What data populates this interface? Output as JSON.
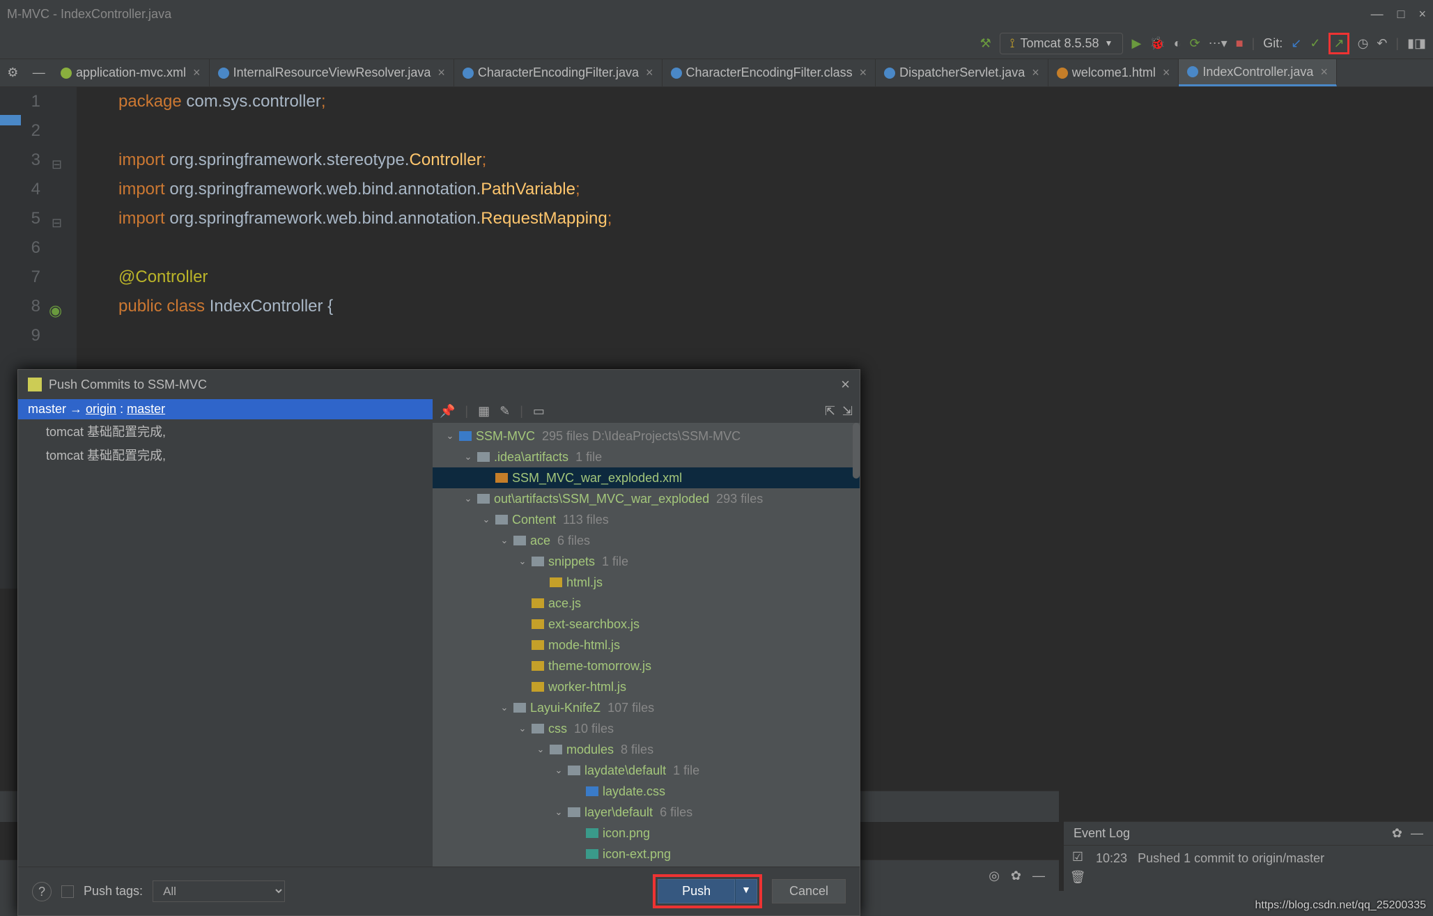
{
  "window": {
    "title": "M-MVC - IndexController.java"
  },
  "toolbar": {
    "run_config": "Tomcat 8.5.58",
    "git_label": "Git:"
  },
  "tabs": [
    {
      "label": "application-mvc.xml",
      "kind": "xml",
      "active": false
    },
    {
      "label": "InternalResourceViewResolver.java",
      "kind": "java",
      "active": false
    },
    {
      "label": "CharacterEncodingFilter.java",
      "kind": "java",
      "active": false
    },
    {
      "label": "CharacterEncodingFilter.class",
      "kind": "class",
      "active": false
    },
    {
      "label": "DispatcherServlet.java",
      "kind": "java",
      "active": false
    },
    {
      "label": "welcome1.html",
      "kind": "html",
      "active": false
    },
    {
      "label": "IndexController.java",
      "kind": "java",
      "active": true
    }
  ],
  "code": {
    "lines": [
      {
        "n": 1,
        "html": "<span class='kw'>package</span> <span class='id'>com.sys.controller</span><span class='pun'>;</span>"
      },
      {
        "n": 2,
        "html": ""
      },
      {
        "n": 3,
        "html": "<span class='kw'>import</span> <span class='id'>org.springframework.stereotype.</span><span class='cls'>Controller</span><span class='pun'>;</span>"
      },
      {
        "n": 4,
        "html": "<span class='kw'>import</span> <span class='id'>org.springframework.web.bind.annotation.</span><span class='cls'>PathVariable</span><span class='pun'>;</span>"
      },
      {
        "n": 5,
        "html": "<span class='kw'>import</span> <span class='id'>org.springframework.web.bind.annotation.</span><span class='cls'>RequestMapping</span><span class='pun'>;</span>"
      },
      {
        "n": 6,
        "html": ""
      },
      {
        "n": 7,
        "html": "<span class='ann'>@Controller</span>"
      },
      {
        "n": 8,
        "html": "<span class='kw'>public class</span> <span class='id'>IndexController {</span>"
      },
      {
        "n": 9,
        "html": ""
      }
    ]
  },
  "dialog": {
    "title": "Push Commits to SSM-MVC",
    "branch_local": "master",
    "branch_arrow": "→",
    "branch_remote": "origin",
    "branch_remote_ref": "master",
    "commits": [
      "tomcat 基础配置完成,",
      "tomcat 基础配置完成,"
    ],
    "push_tags_label": "Push tags:",
    "push_tags_value": "All",
    "push_btn": "Push",
    "cancel_btn": "Cancel",
    "tree": [
      {
        "d": 0,
        "exp": "v",
        "ico": "proj",
        "nm": "SSM-MVC",
        "meta": "295 files  D:\\IdeaProjects\\SSM-MVC",
        "sel": false
      },
      {
        "d": 1,
        "exp": "v",
        "ico": "folder",
        "nm": ".idea\\artifacts",
        "meta": "1 file",
        "sel": false
      },
      {
        "d": 2,
        "exp": "",
        "ico": "xmlf",
        "nm": "SSM_MVC_war_exploded.xml",
        "meta": "",
        "sel": true
      },
      {
        "d": 1,
        "exp": "v",
        "ico": "folder",
        "nm": "out\\artifacts\\SSM_MVC_war_exploded",
        "meta": "293 files",
        "sel": false
      },
      {
        "d": 2,
        "exp": "v",
        "ico": "folder",
        "nm": "Content",
        "meta": "113 files",
        "sel": false
      },
      {
        "d": 3,
        "exp": "v",
        "ico": "folder",
        "nm": "ace",
        "meta": "6 files",
        "sel": false
      },
      {
        "d": 4,
        "exp": "v",
        "ico": "folder",
        "nm": "snippets",
        "meta": "1 file",
        "sel": false
      },
      {
        "d": 5,
        "exp": "",
        "ico": "jsf",
        "nm": "html.js",
        "meta": "",
        "sel": false
      },
      {
        "d": 4,
        "exp": "",
        "ico": "jsf",
        "nm": "ace.js",
        "meta": "",
        "sel": false
      },
      {
        "d": 4,
        "exp": "",
        "ico": "jsf",
        "nm": "ext-searchbox.js",
        "meta": "",
        "sel": false
      },
      {
        "d": 4,
        "exp": "",
        "ico": "jsf",
        "nm": "mode-html.js",
        "meta": "",
        "sel": false
      },
      {
        "d": 4,
        "exp": "",
        "ico": "jsf",
        "nm": "theme-tomorrow.js",
        "meta": "",
        "sel": false
      },
      {
        "d": 4,
        "exp": "",
        "ico": "jsf",
        "nm": "worker-html.js",
        "meta": "",
        "sel": false
      },
      {
        "d": 3,
        "exp": "v",
        "ico": "folder",
        "nm": "Layui-KnifeZ",
        "meta": "107 files",
        "sel": false
      },
      {
        "d": 4,
        "exp": "v",
        "ico": "folder",
        "nm": "css",
        "meta": "10 files",
        "sel": false
      },
      {
        "d": 5,
        "exp": "v",
        "ico": "folder",
        "nm": "modules",
        "meta": "8 files",
        "sel": false
      },
      {
        "d": 6,
        "exp": "v",
        "ico": "folder",
        "nm": "laydate\\default",
        "meta": "1 file",
        "sel": false
      },
      {
        "d": 7,
        "exp": "",
        "ico": "cssf",
        "nm": "laydate.css",
        "meta": "",
        "sel": false
      },
      {
        "d": 6,
        "exp": "v",
        "ico": "folder",
        "nm": "layer\\default",
        "meta": "6 files",
        "sel": false
      },
      {
        "d": 7,
        "exp": "",
        "ico": "pngf",
        "nm": "icon.png",
        "meta": "",
        "sel": false
      },
      {
        "d": 7,
        "exp": "",
        "ico": "pngf",
        "nm": "icon-ext.png",
        "meta": "",
        "sel": false
      }
    ]
  },
  "eventlog": {
    "title": "Event Log",
    "time": "10:23",
    "msg": "Pushed 1 commit to origin/master"
  },
  "watermark": "https://blog.csdn.net/qq_25200335"
}
